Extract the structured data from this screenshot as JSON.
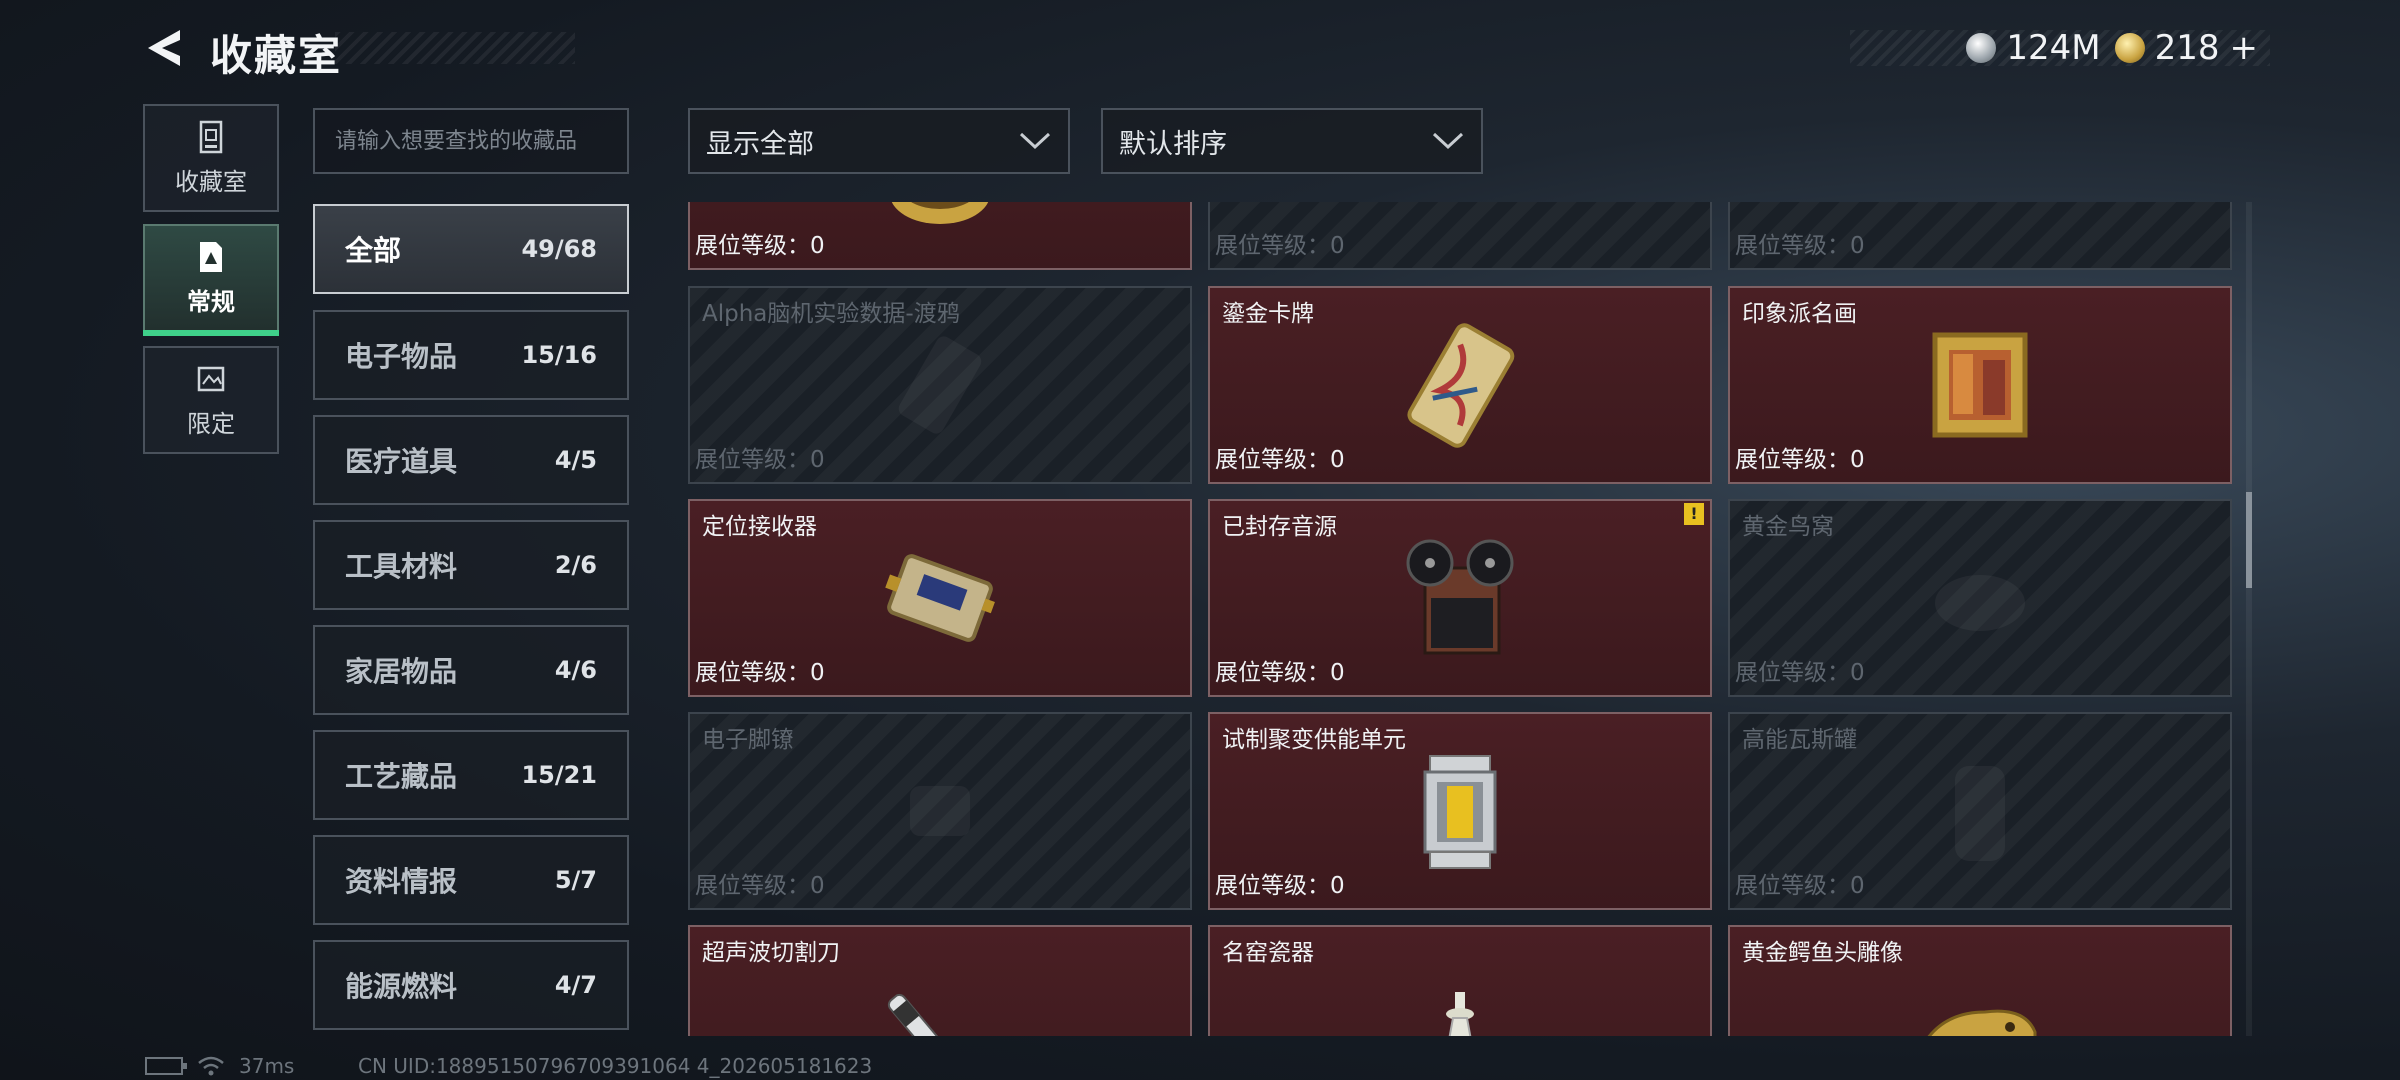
{
  "header": {
    "title": "收藏室",
    "currency": [
      {
        "icon": "silver-coin-icon",
        "value": "124M"
      },
      {
        "icon": "gold-coin-icon",
        "value": "218"
      }
    ],
    "add_symbol": "+"
  },
  "side_tabs": [
    {
      "label": "收藏室",
      "icon": "collection-room-icon",
      "active": false
    },
    {
      "label": "常规",
      "icon": "regular-doc-icon",
      "active": true
    },
    {
      "label": "限定",
      "icon": "limited-icon",
      "active": false
    }
  ],
  "search": {
    "placeholder": "请输入想要查找的收藏品",
    "value": ""
  },
  "categories": [
    {
      "label": "全部",
      "count": "49/68",
      "active": true
    },
    {
      "label": "电子物品",
      "count": "15/16"
    },
    {
      "label": "医疗道具",
      "count": "4/5"
    },
    {
      "label": "工具材料",
      "count": "2/6"
    },
    {
      "label": "家居物品",
      "count": "4/6"
    },
    {
      "label": "工艺藏品",
      "count": "15/21"
    },
    {
      "label": "资料情报",
      "count": "5/7"
    },
    {
      "label": "能源燃料",
      "count": "4/7"
    }
  ],
  "filters": {
    "display": "显示全部",
    "sort": "默认排序"
  },
  "level_label": "展位等级：",
  "items": [
    {
      "name": "",
      "level": "0",
      "unlocked": true,
      "icon": "gold-ring-item"
    },
    {
      "name": "",
      "level": "0",
      "unlocked": false,
      "icon": ""
    },
    {
      "name": "",
      "level": "0",
      "unlocked": false,
      "icon": ""
    },
    {
      "name": "Alpha脑机实验数据-渡鸦",
      "level": "0",
      "unlocked": false,
      "icon": "data-drive-item"
    },
    {
      "name": "鎏金卡牌",
      "level": "0",
      "unlocked": true,
      "icon": "gilded-card-item"
    },
    {
      "name": "印象派名画",
      "level": "0",
      "unlocked": true,
      "icon": "painting-item"
    },
    {
      "name": "定位接收器",
      "level": "0",
      "unlocked": true,
      "icon": "receiver-item"
    },
    {
      "name": "已封存音源",
      "level": "0",
      "unlocked": true,
      "icon": "tape-recorder-item",
      "warning": "!"
    },
    {
      "name": "黄金鸟窝",
      "level": "0",
      "unlocked": false,
      "icon": "bird-nest-item"
    },
    {
      "name": "电子脚镣",
      "level": "0",
      "unlocked": false,
      "icon": "ankle-monitor-item"
    },
    {
      "name": "试制聚变供能单元",
      "level": "0",
      "unlocked": true,
      "icon": "fusion-cell-item"
    },
    {
      "name": "高能瓦斯罐",
      "level": "0",
      "unlocked": false,
      "icon": "gas-tank-item"
    },
    {
      "name": "超声波切割刀",
      "level": "0",
      "unlocked": true,
      "icon": "cutter-item"
    },
    {
      "name": "名窑瓷器",
      "level": "0",
      "unlocked": true,
      "icon": "porcelain-item"
    },
    {
      "name": "黄金鳄鱼头雕像",
      "level": "0",
      "unlocked": true,
      "icon": "croc-statue-item"
    }
  ],
  "status": {
    "ping": "37ms",
    "uid": "CN UID:18895150796709391064 4_202605181623"
  }
}
